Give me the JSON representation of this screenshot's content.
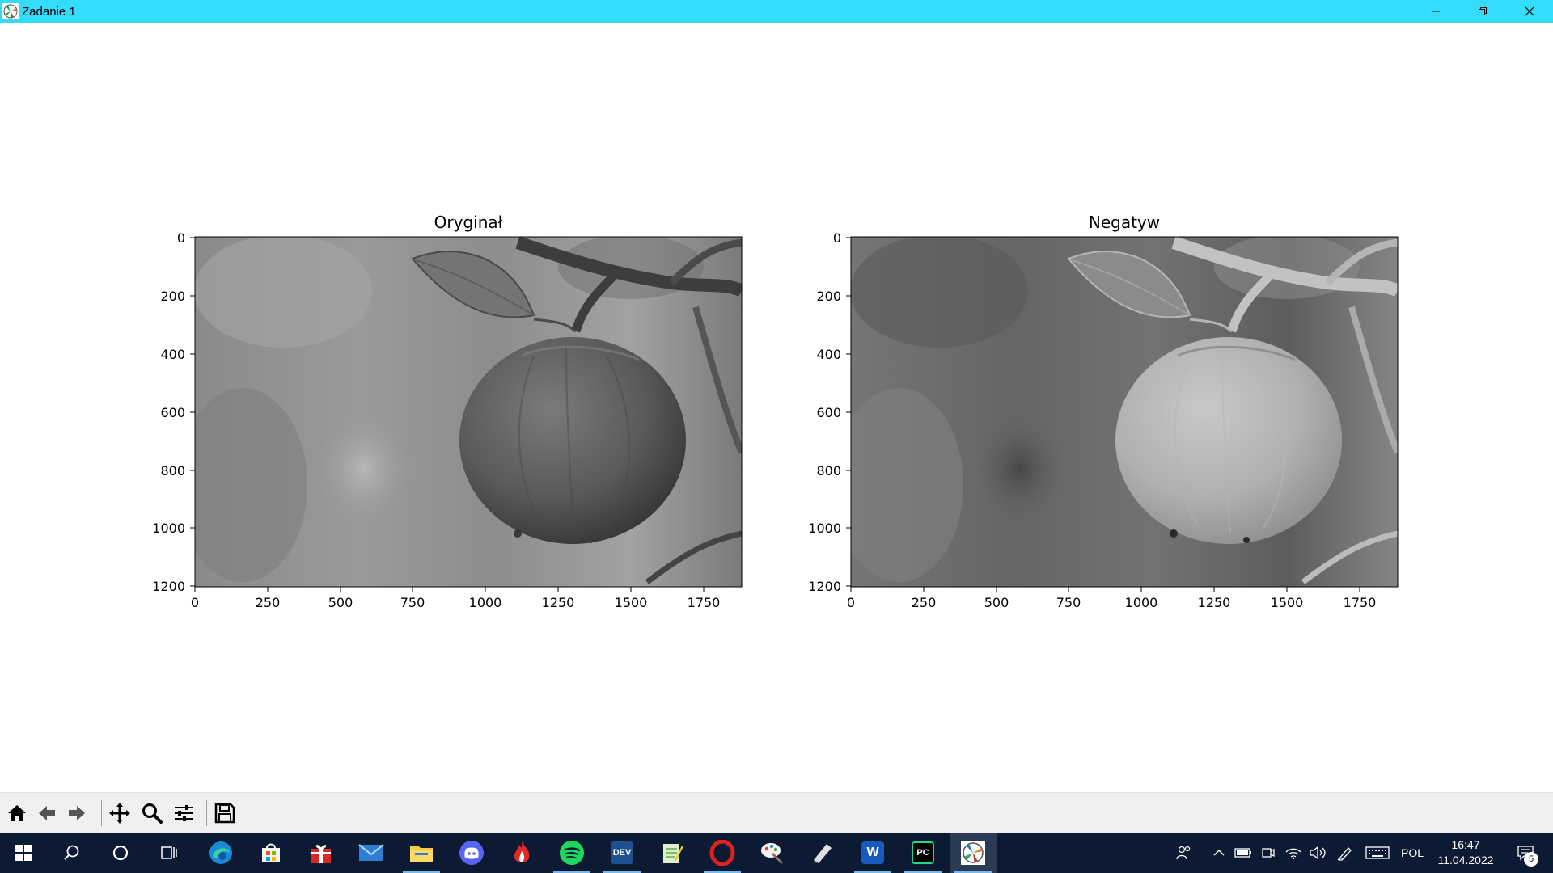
{
  "window": {
    "title": "Zadanie 1",
    "titlebar_color": "#33dcfb"
  },
  "figure": {
    "subplots": [
      {
        "title": "Oryginał",
        "image": "grayscale photo of an apple hanging on a branch",
        "x_ticks": [
          "0",
          "250",
          "500",
          "750",
          "1000",
          "1250",
          "1500",
          "1750"
        ],
        "y_ticks": [
          "0",
          "200",
          "400",
          "600",
          "800",
          "1000",
          "1200"
        ],
        "xlim": [
          0,
          1880
        ],
        "ylim": [
          1200,
          0
        ],
        "inverted": false
      },
      {
        "title": "Negatyw",
        "image": "negative of the same grayscale apple photo",
        "x_ticks": [
          "0",
          "250",
          "500",
          "750",
          "1000",
          "1250",
          "1500",
          "1750"
        ],
        "y_ticks": [
          "0",
          "200",
          "400",
          "600",
          "800",
          "1000",
          "1200"
        ],
        "xlim": [
          0,
          1880
        ],
        "ylim": [
          1200,
          0
        ],
        "inverted": true
      }
    ]
  },
  "toolbar": {
    "buttons": [
      {
        "name": "home",
        "icon": "home-icon"
      },
      {
        "name": "back",
        "icon": "arrow-left-icon"
      },
      {
        "name": "forward",
        "icon": "arrow-right-icon"
      },
      {
        "name": "pan",
        "icon": "move-icon"
      },
      {
        "name": "zoom",
        "icon": "zoom-icon"
      },
      {
        "name": "configure",
        "icon": "sliders-icon"
      },
      {
        "name": "save",
        "icon": "save-icon"
      }
    ]
  },
  "taskbar": {
    "apps": [
      {
        "name": "edge",
        "icon": "edge-icon"
      },
      {
        "name": "store",
        "icon": "store-icon"
      },
      {
        "name": "gift",
        "icon": "gift-icon"
      },
      {
        "name": "mail",
        "icon": "mail-icon"
      },
      {
        "name": "file-explorer",
        "icon": "folder-icon"
      },
      {
        "name": "discord",
        "icon": "discord-icon"
      },
      {
        "name": "app-flame",
        "icon": "flame-icon"
      },
      {
        "name": "spotify",
        "icon": "spotify-icon"
      },
      {
        "name": "devcpp",
        "icon": "dev-cpp-icon",
        "label": "DEV"
      },
      {
        "name": "notepad",
        "icon": "notepad-icon"
      },
      {
        "name": "opera",
        "icon": "opera-icon"
      },
      {
        "name": "paint",
        "icon": "paint-icon"
      },
      {
        "name": "app-pen",
        "icon": "pen-icon"
      },
      {
        "name": "word",
        "icon": "word-icon",
        "label": "W"
      },
      {
        "name": "pycharm",
        "icon": "pycharm-icon",
        "label": "PC"
      },
      {
        "name": "matplotlib",
        "icon": "matplotlib-icon"
      }
    ],
    "language": "POL",
    "time": "16:47",
    "date": "11.04.2022",
    "notification_count": "5"
  }
}
